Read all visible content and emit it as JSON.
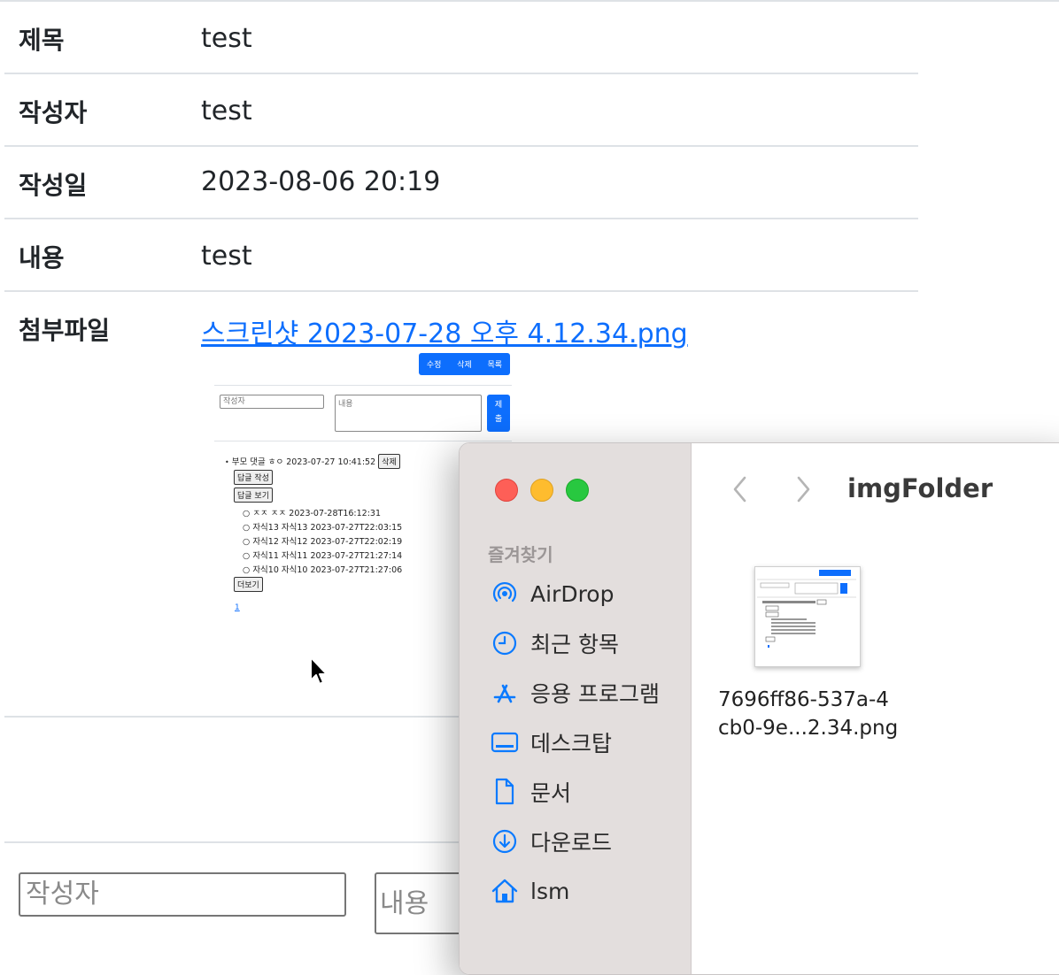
{
  "detail": {
    "rows": [
      {
        "label": "제목",
        "value": "test"
      },
      {
        "label": "작성자",
        "value": "test"
      },
      {
        "label": "작성일",
        "value": "2023-08-06 20:19"
      },
      {
        "label": "내용",
        "value": "test"
      }
    ],
    "attachment_label": "첨부파일",
    "attachment_link": "스크린샷 2023-07-28 오후 4.12.34.png"
  },
  "preview": {
    "buttons": [
      "수정",
      "삭제",
      "목록"
    ],
    "author_placeholder": "작성자",
    "content_placeholder": "내용",
    "submit_label": "제출",
    "parent_comment": "부모 댓글 ㅎㅇ 2023-07-27 10:41:52",
    "delete_label": "삭제",
    "reply_write_label": "답글 작성",
    "reply_view_label": "답글 보기",
    "children": [
      "ㅈㅈ ㅈㅈ 2023-07-28T16:12:31",
      "자식13 자식13 2023-07-27T22:03:15",
      "자식12 자식12 2023-07-27T22:02:19",
      "자식11 자식11 2023-07-27T21:27:14",
      "자식10 자식10 2023-07-27T21:27:06"
    ],
    "more_label": "더보기",
    "page_number": "1"
  },
  "comment_form": {
    "author_placeholder": "작성자",
    "content_placeholder": "내용"
  },
  "finder": {
    "favorites_header": "즐겨찾기",
    "sidebar_items": [
      {
        "label": "AirDrop",
        "icon": "airdrop-icon"
      },
      {
        "label": "최근 항목",
        "icon": "clock-icon"
      },
      {
        "label": "응용 프로그램",
        "icon": "applications-icon"
      },
      {
        "label": "데스크탑",
        "icon": "desktop-icon"
      },
      {
        "label": "문서",
        "icon": "document-icon"
      },
      {
        "label": "다운로드",
        "icon": "download-icon"
      },
      {
        "label": "lsm",
        "icon": "home-icon"
      }
    ],
    "folder_title": "imgFolder",
    "file_name_line1": "7696ff86-537a-4",
    "file_name_line2": "cb0-9e...2.34.png",
    "accent_color": "#0a7aff"
  }
}
